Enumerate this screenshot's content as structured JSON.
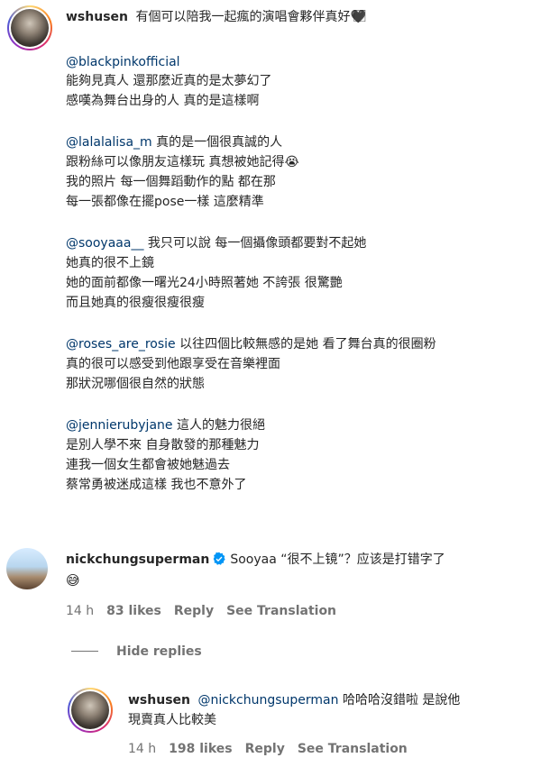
{
  "comment1": {
    "username": "wshusen",
    "headline": "有個可以陪我一起瘋的演唱會夥伴真好🖤⃞",
    "block1": {
      "mention": "@blackpinkofficial",
      "lines": [
        "能夠見真人 還那麼近真的是太夢幻了",
        "感嘆為舞台出身的人 真的是這樣啊"
      ]
    },
    "block2": {
      "mention": "@lalalalisa_m",
      "first_text": " 真的是一個很真誠的人",
      "lines": [
        "跟粉絲可以像朋友這樣玩 真想被她記得😭",
        "我的照片 每一個舞蹈動作的點 都在那",
        "每一張都像在擺pose一樣 這麼精準"
      ]
    },
    "block3": {
      "mention": "@sooyaaa__",
      "first_text": " 我只可以說 每一個攝像頭都要對不起她",
      "lines": [
        "她真的很不上鏡",
        "她的面前都像一曙光24小時照著她 不誇張 很驚艷",
        "而且她真的很瘦很瘦很瘦"
      ]
    },
    "block4": {
      "mention": "@roses_are_rosie",
      "first_text": " 以往四個比較無感的是她 看了舞台真的很圈粉",
      "lines": [
        "真的很可以感受到他跟享受在音樂裡面",
        "那狀況哪個很自然的狀態"
      ]
    },
    "block5": {
      "mention": "@jennierubyjane",
      "first_text": " 這人的魅力很絕",
      "lines": [
        "是別人學不來 自身散發的那種魅力",
        "連我一個女生都會被她魅過去",
        "蔡常勇被迷成這樣 我也不意外了"
      ]
    }
  },
  "comment2": {
    "username": "nickchungsuperman",
    "text": "Sooyaa “很不上镜”？应该是打错字了",
    "emoji": "😅",
    "time": "14 h",
    "likes": "83 likes",
    "reply": "Reply",
    "translation": "See Translation",
    "hide_replies": "Hide replies"
  },
  "reply1": {
    "username": "wshusen",
    "mention": "@nickchungsuperman",
    "text": " 哈哈哈沒錯啦 是說他",
    "line2": "現賣真人比較美",
    "time": "14 h",
    "likes": "198 likes",
    "reply": "Reply",
    "translation": "See Translation"
  },
  "colors": {
    "text": "#262626",
    "mention": "#00376b",
    "meta": "#737373",
    "verified": "#0095f6"
  },
  "icons": [
    "verified-badge-icon",
    "avatar"
  ]
}
